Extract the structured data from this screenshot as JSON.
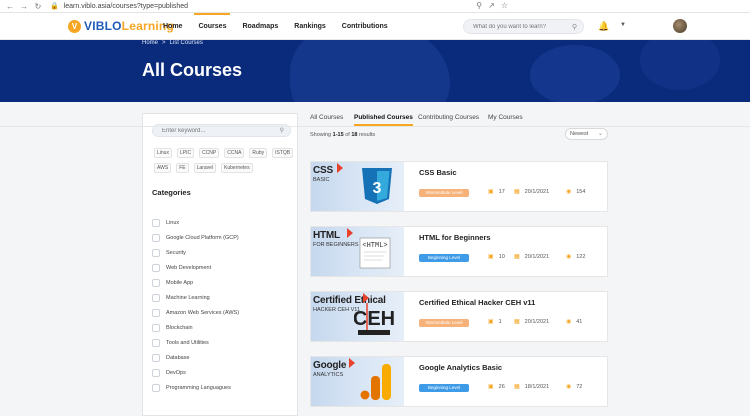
{
  "browser": {
    "url": "learn.viblo.asia/courses?type=published"
  },
  "header": {
    "logo_text_a": "VIBLO",
    "logo_text_b": "Learning",
    "nav": [
      {
        "label": "Home",
        "active": false
      },
      {
        "label": "Courses",
        "active": true
      },
      {
        "label": "Roadmaps",
        "active": false
      },
      {
        "label": "Rankings",
        "active": false
      },
      {
        "label": "Contributions",
        "active": false
      }
    ],
    "search_placeholder": "What do you want to learn?"
  },
  "hero": {
    "breadcrumb": [
      "Home",
      ">",
      "List Courses"
    ],
    "title": "All Courses"
  },
  "sidebar": {
    "search_placeholder": "Enter keyword...",
    "tags": [
      "Linux",
      "LPIC",
      "CCNP",
      "CCNA",
      "Ruby",
      "ISTQB",
      "AWS",
      "FE",
      "Laravel",
      "Kubernetes"
    ],
    "categories_title": "Categories",
    "categories": [
      "Linux",
      "Google Cloud Platform (GCP)",
      "Security",
      "Web Development",
      "Mobile App",
      "Machine Learning",
      "Amazon Web Services (AWS)",
      "Blockchain",
      "Tools and Utilities",
      "Database",
      "DevOps",
      "Programming Languagues"
    ]
  },
  "main": {
    "tabs": [
      {
        "label": "All Courses",
        "active": false
      },
      {
        "label": "Published Courses",
        "active": true
      },
      {
        "label": "Contributing Courses",
        "active": false
      },
      {
        "label": "My Courses",
        "active": false
      }
    ],
    "results": {
      "prefix": "Showing",
      "range": "1-15",
      "of": "of",
      "total": "18",
      "suffix": "results"
    },
    "sort": "Newest",
    "courses": [
      {
        "name": "CSS Basic",
        "thumb_title": "CSS",
        "thumb_sub": "BASIC",
        "level": "Intermediate Level",
        "level_type": "inter",
        "lessons": "17",
        "date": "20/1/2021",
        "views": "154"
      },
      {
        "name": "HTML for Beginners",
        "thumb_title": "HTML",
        "thumb_sub": "FOR BEGINNERS",
        "level": "Beginning Level",
        "level_type": "begin",
        "lessons": "10",
        "date": "20/1/2021",
        "views": "122"
      },
      {
        "name": "Certified Ethical Hacker CEH v11",
        "thumb_title": "Certified Ethical",
        "thumb_sub": "HACKER CEH V11",
        "level": "Intermediate Level",
        "level_type": "inter",
        "lessons": "1",
        "date": "20/1/2021",
        "views": "41"
      },
      {
        "name": "Google Analytics Basic",
        "thumb_title": "Google",
        "thumb_sub": "ANALYTICS",
        "level": "Beginning Level",
        "level_type": "begin",
        "lessons": "26",
        "date": "18/1/2021",
        "views": "72"
      }
    ]
  },
  "colors": {
    "accent": "#f5a623",
    "hero": "#0a2b7c",
    "brand": "#1e5bb8"
  }
}
